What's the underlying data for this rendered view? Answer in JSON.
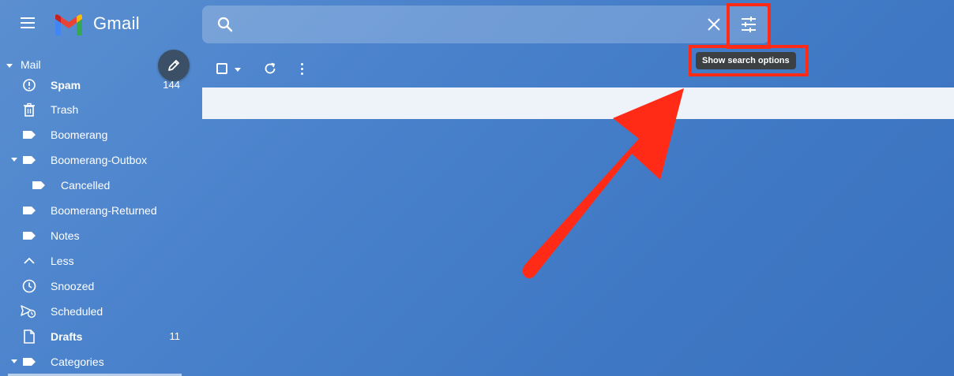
{
  "header": {
    "brand": "Gmail",
    "search": {
      "placeholder": "",
      "value": ""
    },
    "tooltip": "Show search options"
  },
  "sidebar": {
    "section_label": "Mail",
    "items": [
      {
        "label": "Spam",
        "count": "144",
        "icon": "spam-icon",
        "bold": true
      },
      {
        "label": "Trash",
        "count": "",
        "icon": "trash-icon"
      },
      {
        "label": "Boomerang",
        "count": "",
        "icon": "label-icon"
      },
      {
        "label": "Boomerang-Outbox",
        "count": "",
        "icon": "label-icon",
        "expanded": true
      },
      {
        "label": "Cancelled",
        "count": "",
        "icon": "label-icon",
        "indent": true
      },
      {
        "label": "Boomerang-Returned",
        "count": "",
        "icon": "label-icon"
      },
      {
        "label": "Notes",
        "count": "",
        "icon": "label-icon"
      },
      {
        "label": "Less",
        "count": "",
        "icon": "chevron-up-icon"
      },
      {
        "label": "Snoozed",
        "count": "",
        "icon": "clock-icon"
      },
      {
        "label": "Scheduled",
        "count": "",
        "icon": "scheduled-icon"
      },
      {
        "label": "Drafts",
        "count": "11",
        "icon": "draft-icon",
        "bold": true
      },
      {
        "label": "Categories",
        "count": "",
        "icon": "label-icon",
        "expanded": true
      }
    ]
  },
  "colors": {
    "accent_highlight": "#ff2b16",
    "background": "#4a82cc",
    "tooltip_bg": "#3c4043",
    "compose_bg": "#3b4f66"
  }
}
